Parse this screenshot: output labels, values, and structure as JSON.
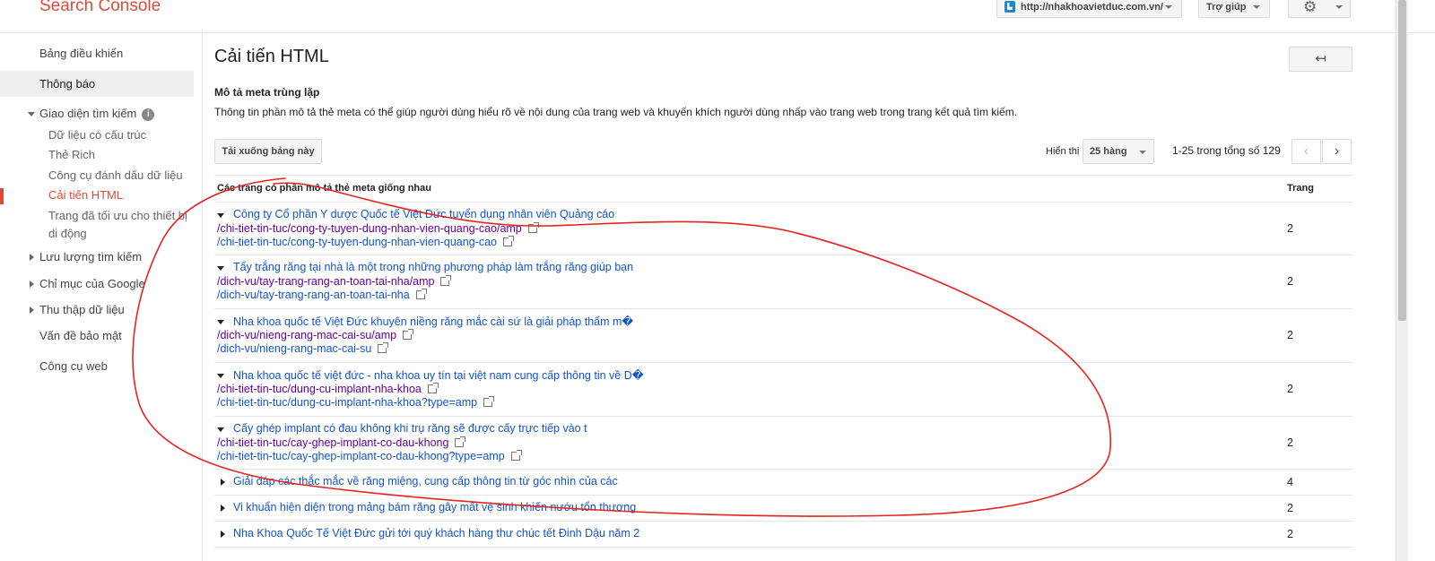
{
  "header": {
    "brand": "Search Console",
    "site_url": "http://nhakhoavietduc.com.vn/",
    "help_label": "Trợ giúp"
  },
  "sidebar": {
    "items": [
      {
        "label": "Bảng điều khiển"
      },
      {
        "label": "Thông báo"
      },
      {
        "label": "Giao diện tìm kiếm"
      },
      {
        "label": "Lưu lượng tìm kiếm"
      },
      {
        "label": "Chỉ mục của Google"
      },
      {
        "label": "Thu thập dữ liệu"
      },
      {
        "label": "Vấn đề bảo mật"
      },
      {
        "label": "Công cụ web"
      }
    ],
    "sub_items": [
      {
        "label": "Dữ liệu có cấu trúc"
      },
      {
        "label": "Thẻ Rich"
      },
      {
        "label": "Công cụ đánh dấu dữ liệu"
      },
      {
        "label": "Cải tiến HTML"
      },
      {
        "label": "Trang đã tối ưu cho thiết bị di động"
      }
    ]
  },
  "main": {
    "title": "Cải tiến HTML",
    "back_symbol": "↤",
    "section_title": "Mô tả meta trùng lặp",
    "section_desc": "Thông tin phần mô tả thẻ meta có thể giúp người dùng hiểu rõ về nội dung của trang web và khuyến khích người dùng nhấp vào trang web trong trang kết quả tìm kiếm.",
    "download_label": "Tải xuống bảng này",
    "show_label": "Hiển thị",
    "rows_value": "25 hàng",
    "range_text": "1-25 trong tổng số 129",
    "prev_symbol": "‹",
    "next_symbol": "›"
  },
  "table": {
    "col_main": "Các trang có phần mô tả thẻ meta giống nhau",
    "col_count": "Trang",
    "rows": [
      {
        "title": "Công ty Cổ phần Y dược Quốc tế Việt Đức tuyển dụng nhân viên Quảng cáo",
        "link1": "/chi-tiet-tin-tuc/cong-ty-tuyen-dung-nhan-vien-quang-cao/amp",
        "link2": "/chi-tiet-tin-tuc/cong-ty-tuyen-dung-nhan-vien-quang-cao",
        "count": "2"
      },
      {
        "title": "Tẩy trắng răng tại nhà là một trong những phương pháp làm trắng răng giúp bạn",
        "link1": "/dich-vu/tay-trang-rang-an-toan-tai-nha/amp",
        "link2": "/dich-vu/tay-trang-rang-an-toan-tai-nha",
        "count": "2"
      },
      {
        "title": "Nha khoa quốc tế Việt Đức khuyên niềng răng mắc cài sứ là giải pháp thẩm m�",
        "link1": "/dich-vu/nieng-rang-mac-cai-su/amp",
        "link2": "/dich-vu/nieng-rang-mac-cai-su",
        "count": "2"
      },
      {
        "title": "Nha khoa quốc tế việt đức - nha khoa uy tín tại việt nam cung cấp thông tin về D�",
        "link1": "/chi-tiet-tin-tuc/dung-cu-implant-nha-khoa",
        "link2": "/chi-tiet-tin-tuc/dung-cu-implant-nha-khoa?type=amp",
        "count": "2"
      },
      {
        "title": "Cấy ghép implant có đau không khi trụ răng sẽ được cấy trực tiếp vào t",
        "link1": "/chi-tiet-tin-tuc/cay-ghep-implant-co-dau-khong",
        "link2": "/chi-tiet-tin-tuc/cay-ghep-implant-co-dau-khong?type=amp",
        "count": "2"
      },
      {
        "title": "Giải đáp các thắc mắc về răng miệng, cung cấp thông tin từ góc nhìn của các",
        "count": "4"
      },
      {
        "title": "Vi khuẩn hiện diện trong mảng bám răng gây mất vệ sinh khiến nướu tổn thương",
        "count": "2"
      },
      {
        "title": "Nha Khoa Quốc Tế Việt Đức gửi tới quý khách hàng thư chúc tết Đinh Dậu năm 2",
        "count": "2"
      }
    ]
  },
  "colors": {
    "brand": "#dd4b39",
    "link": "#1155cc",
    "visited_link": "#660099",
    "annotation": "#e8231f"
  }
}
